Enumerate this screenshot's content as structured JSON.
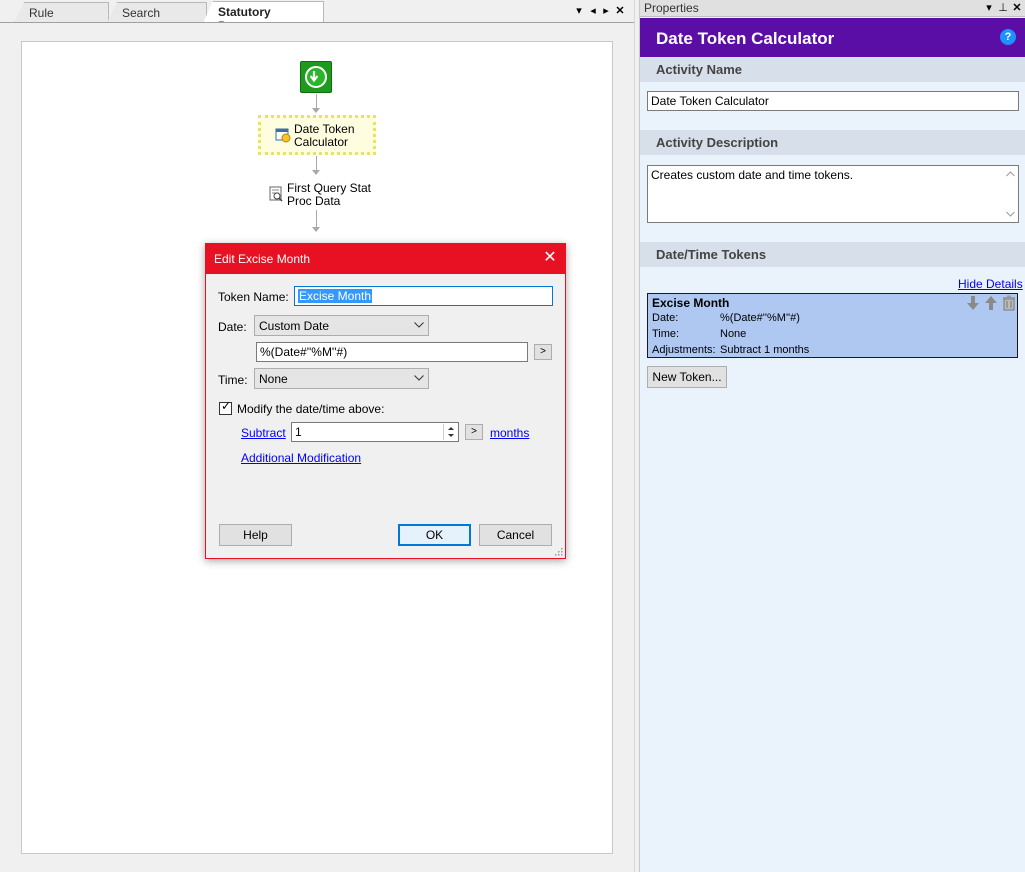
{
  "tabs": [
    "Rule Manager",
    "Search Results",
    "Statutory Process"
  ],
  "tab_controls": {
    "dropdown": "▾",
    "prev": "◂",
    "next": "▸",
    "close": "✕"
  },
  "workflow": {
    "nodes": [
      {
        "label_line1": "Date Token",
        "label_line2": "Calculator"
      },
      {
        "label_line1": "First Query Stat",
        "label_line2": "Proc Data"
      }
    ]
  },
  "dialog": {
    "title": "Edit Excise Month",
    "close_glyph": "✕",
    "token_name_label": "Token Name:",
    "token_name_value": "Excise Month",
    "date_label": "Date:",
    "date_selected": "Custom Date",
    "date_expression": "%(Date#''%M''#)",
    "time_label": "Time:",
    "time_selected": "None",
    "modify_label": "Modify the date/time above:",
    "modify_checked": true,
    "operation_link": "Subtract",
    "amount_value": "1",
    "unit_link": "months",
    "additional_link": "Additional Modification",
    "arrow_button": ">",
    "help_button": "Help",
    "ok_button": "OK",
    "cancel_button": "Cancel"
  },
  "properties": {
    "header_title": "Properties",
    "header_controls": {
      "dropdown": "▾",
      "pin": "⊥",
      "close": "✕"
    },
    "banner_title": "Date Token Calculator",
    "help_glyph": "?",
    "activity_name_header": "Activity Name",
    "activity_name_value": "Date Token Calculator",
    "activity_description_header": "Activity Description",
    "activity_description_value": "Creates custom date and time tokens.",
    "tokens_header": "Date/Time Tokens",
    "hide_details_link": "Hide Details",
    "token": {
      "name": "Excise Month",
      "date_label": "Date:",
      "date_value": "%(Date#''%M''#)",
      "time_label": "Time:",
      "time_value": "None",
      "adjustments_label": "Adjustments:",
      "adjustments_value": "Subtract 1 months"
    },
    "new_token_button": "New Token..."
  }
}
